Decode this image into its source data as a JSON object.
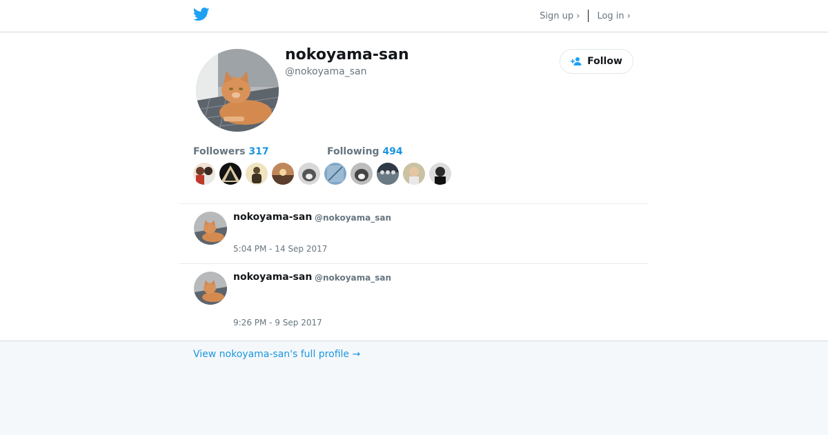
{
  "header": {
    "signup_label": "Sign up ›",
    "login_label": "Log in ›"
  },
  "profile": {
    "name": "nokoyama-san",
    "handle": "@nokoyama_san",
    "follow_label": "Follow",
    "followers_label": "Followers",
    "followers_count": "317",
    "following_label": "Following",
    "following_count": "494"
  },
  "tweets": [
    {
      "name": "nokoyama-san",
      "handle": "@nokoyama_san",
      "time": "5:04 PM - 14 Sep 2017"
    },
    {
      "name": "nokoyama-san",
      "handle": "@nokoyama_san",
      "time": "9:26 PM - 9 Sep 2017"
    }
  ],
  "footer": {
    "full_profile_link": "View nokoyama-san's full profile →"
  },
  "colors": {
    "accent": "#1b95e0",
    "twitter_blue": "#1da1f2",
    "muted_text": "#66757f"
  }
}
